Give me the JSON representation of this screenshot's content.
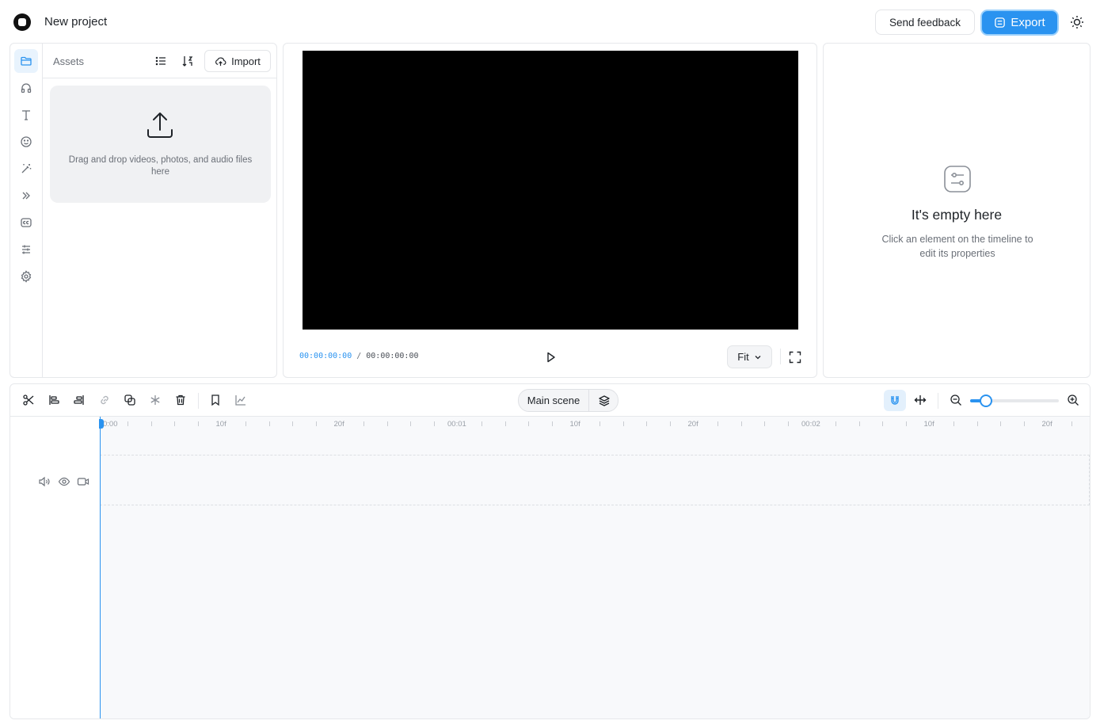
{
  "header": {
    "project_title": "New project",
    "feedback_label": "Send feedback",
    "export_label": "Export"
  },
  "assets": {
    "title": "Assets",
    "import_label": "Import",
    "drop_text": "Drag and drop videos, photos, and audio files here"
  },
  "sidebar": {
    "items": [
      {
        "icon": "folder-icon",
        "active": true
      },
      {
        "icon": "headphones-icon",
        "active": false
      },
      {
        "icon": "text-icon",
        "active": false
      },
      {
        "icon": "smiley-icon",
        "active": false
      },
      {
        "icon": "magic-wand-icon",
        "active": false
      },
      {
        "icon": "transitions-icon",
        "active": false
      },
      {
        "icon": "captions-icon",
        "active": false
      },
      {
        "icon": "sliders-icon",
        "active": false
      },
      {
        "icon": "gear-icon",
        "active": false
      }
    ]
  },
  "player": {
    "current_time": "00:00:00:00",
    "separator": "/",
    "duration": "00:00:00:00",
    "fit_label": "Fit"
  },
  "properties": {
    "empty_title": "It's empty here",
    "empty_subtitle": "Click an element on the timeline to edit its properties"
  },
  "timeline": {
    "scene_label": "Main scene",
    "zoom_level": 0.18,
    "ruler_labels": [
      "0:00",
      "10f",
      "20f",
      "00:01",
      "10f",
      "20f",
      "00:02",
      "10f",
      "20f"
    ]
  },
  "colors": {
    "accent": "#2a93f0",
    "export_border": "#9bd0fb",
    "video_bg": "#000000",
    "timeline_bg": "#f8f9fb"
  }
}
